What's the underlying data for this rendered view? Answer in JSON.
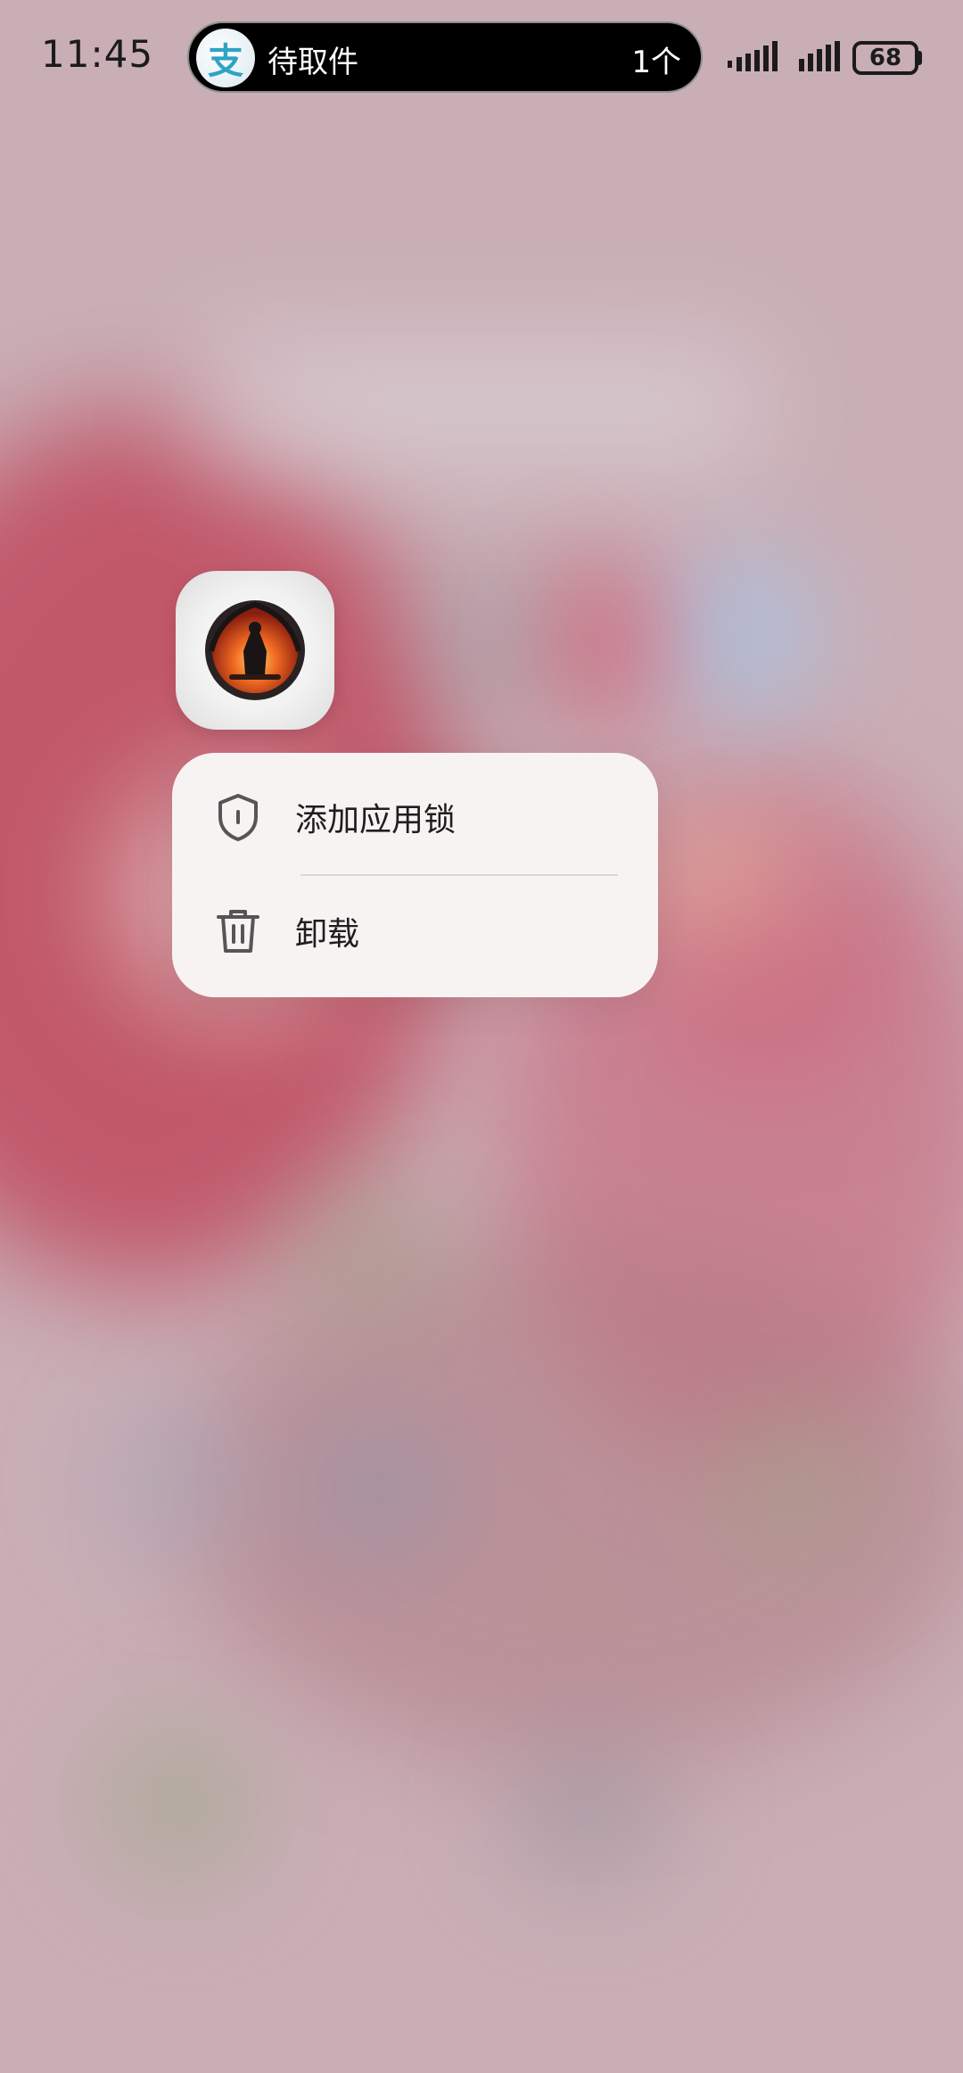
{
  "status_bar": {
    "time": "11:45",
    "battery": "68"
  },
  "island": {
    "app_glyph": "支",
    "title": "待取件",
    "count": "1个"
  },
  "menu": {
    "items": [
      {
        "label": "添加应用锁",
        "icon": "shield-icon"
      },
      {
        "label": "卸载",
        "icon": "trash-icon"
      }
    ]
  }
}
